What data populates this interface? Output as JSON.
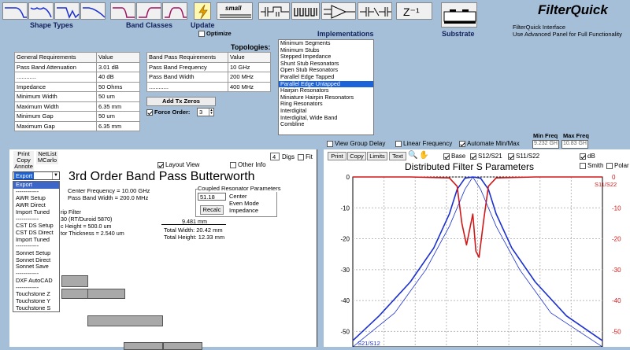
{
  "toolbar": {
    "shape_types_label": "Shape Types",
    "band_classes_label": "Band Classes",
    "update_label": "Update",
    "optimize_label": "Optimize",
    "small_label": "small",
    "implementations_label": "Implementations",
    "substrate_label": "Substrate",
    "z_minus_one": "Z⁻¹",
    "app_title": "FilterQuick",
    "app_subtitle": "FilterQuick Interface",
    "app_subtitle2": "Use Advanced Panel for Full Functionality"
  },
  "topologies_label": "Topologies:",
  "general_table": {
    "headers": [
      "General Requirements",
      "Value"
    ],
    "rows": [
      [
        "Pass Band Attenuation",
        "3.01 dB"
      ],
      [
        "............",
        "40 dB"
      ],
      [
        "Impedance",
        "50 Ohms"
      ],
      [
        "Minimum Width",
        "50 um"
      ],
      [
        "Maximum Width",
        "6.35 mm"
      ],
      [
        "Minimum Gap",
        "50 um"
      ],
      [
        "Maximum Gap",
        "6.35 mm"
      ]
    ]
  },
  "bandpass_table": {
    "headers": [
      "Band Pass Requirements",
      "Value"
    ],
    "rows": [
      [
        "Pass Band Frequency",
        "10 GHz"
      ],
      [
        "Pass Band Width",
        "200 MHz"
      ],
      [
        "............",
        "400 MHz"
      ]
    ]
  },
  "add_tx_zeros_label": "Add Tx Zeros",
  "force_order_label": "Force Order:",
  "force_order_value": "3",
  "topologies": [
    "Minimum Segments",
    "Minimum Stubs",
    "Stepped Impedance",
    "Shunt Stub Resonators",
    "Open Stub Resonators",
    "Parallel Edge Tapped",
    "Parallel Edge Untapped",
    "Hairpin Resonators",
    "Miniature Hairpin Resonators",
    "Ring Resonators",
    "Interdigital",
    "Interdigital, Wide Band",
    "Combline"
  ],
  "topology_selected": "Parallel Edge Untapped",
  "layout_panel": {
    "print": "Print",
    "copy": "Copy",
    "annote": "Annote",
    "netlist": "NetList",
    "mcarlo": "MCarlo",
    "digs_value": "4",
    "digs_label": "Digs",
    "fit_label": "Fit",
    "layout_view_label": "Layout View",
    "other_info_label": "Other Info",
    "title": "3rd Order Band Pass Butterworth",
    "center_freq": "Center Frequency = 10.00 GHz",
    "pass_band_width": "Pass Band Width = 200.0 MHz",
    "coupled_title": "Coupled Resonator Parameters",
    "coupled_value": "51.18",
    "center_label": "Center",
    "even_mode_label": "Even Mode",
    "impedance_label": "Impedance",
    "recalc": "Recalc",
    "substrate_line1": "rip Filter",
    "substrate_line2": "30  (RT/Duroid 5870)",
    "substrate_line3": "c Height = 500.0 um",
    "substrate_line4": "tor Thickness = 2.540 um",
    "dim_width": "9.481 mm",
    "total_width": "Total Width: 20.42 mm",
    "total_height": "Total Height: 12.33 mm"
  },
  "export_dropdown": {
    "value": "Export",
    "items": [
      "Export",
      "------------",
      "AWR Setup",
      "AWR Direct",
      "Import Tuned",
      "------------",
      "CST DS Setup",
      "CST DS Direct",
      "Import Tuned",
      "------------",
      "Sonnet Setup",
      "Sonnet Direct",
      "Sonnet Save",
      "------------",
      "DXF AutoCAD",
      "------------",
      "Touchstone Z",
      "Touchstone Y",
      "Touchstone S"
    ]
  },
  "options": {
    "view_group_delay": "View Group Delay",
    "linear_frequency": "Linear Frequency",
    "automate_min_max": "Automate Min/Max",
    "min_freq_label": "Min Freq",
    "max_freq_label": "Max Freq",
    "min_freq_value": "9.232 GH",
    "max_freq_value": "10.83 GH"
  },
  "plot_panel": {
    "print": "Print",
    "copy": "Copy",
    "limits": "Limits",
    "text": "Text",
    "base": "Base",
    "s12s21": "S12/S21",
    "s11s22": "S11/S22",
    "db": "dB",
    "smith": "Smith",
    "polar": "Polar",
    "legend_s11": "S11/S22",
    "legend_s21": "S21/S12"
  },
  "chart_data": {
    "type": "line",
    "title": "Distributed Filter S Parameters",
    "xlim": [
      9.232,
      10.83
    ],
    "ylim": [
      -55,
      0
    ],
    "yticks_left": [
      "0",
      "-10",
      "-20",
      "-30",
      "-40",
      "-50"
    ],
    "yticks_right": [
      "0",
      "-10",
      "-20",
      "-30",
      "-40",
      "-50"
    ],
    "y_values": [
      0,
      -10,
      -20,
      -30,
      -40,
      -50
    ],
    "grid": true,
    "series": [
      {
        "name": "S21/S12",
        "color": "#1a2fd0",
        "x": [
          9.232,
          9.4,
          9.6,
          9.75,
          9.85,
          9.9,
          9.95,
          10.0,
          10.05,
          10.1,
          10.15,
          10.25,
          10.4,
          10.6,
          10.83
        ],
        "y": [
          -53,
          -45,
          -34,
          -23,
          -12,
          -4,
          -0.4,
          0,
          -0.4,
          -4,
          -12,
          -23,
          -34,
          -45,
          -53
        ]
      },
      {
        "name": "S11/S22",
        "color": "#d01818",
        "x": [
          9.232,
          9.6,
          9.85,
          9.9,
          9.93,
          9.96,
          9.98,
          10.0,
          10.02,
          10.04,
          10.07,
          10.1,
          10.15,
          10.4,
          10.83
        ],
        "y": [
          0,
          0,
          -0.3,
          -3,
          -15,
          -22,
          -17,
          -12,
          -24,
          -26,
          -14,
          -3,
          -0.3,
          0,
          0
        ]
      },
      {
        "name": "base",
        "color": "#1a2fd0",
        "x": [
          9.232,
          9.5,
          9.7,
          9.85,
          9.95,
          10.0,
          10.05,
          10.15,
          10.3,
          10.5,
          10.83
        ],
        "y": [
          -55,
          -44,
          -30,
          -16,
          -4,
          0,
          -4,
          -16,
          -30,
          -44,
          -55
        ]
      }
    ]
  }
}
